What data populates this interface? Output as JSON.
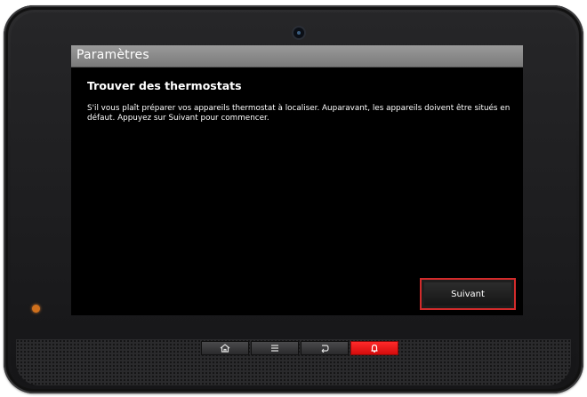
{
  "screen": {
    "title": "Paramètres",
    "heading": "Trouver des thermostats",
    "instructions": "S'il vous plaît préparer vos appareils thermostat à localiser. Auparavant, les appareils doivent être situés en défaut. Appuyez sur Suivant pour commencer.",
    "next_label": "Suivant"
  },
  "hardware_keys": [
    {
      "name": "home",
      "icon": "home-icon"
    },
    {
      "name": "menu",
      "icon": "menu-icon"
    },
    {
      "name": "back",
      "icon": "back-icon"
    },
    {
      "name": "alarm",
      "icon": "bell-icon"
    }
  ],
  "colors": {
    "highlight_border": "#d22b2b",
    "alarm_key": "#e81414",
    "led": "#d0701c"
  }
}
